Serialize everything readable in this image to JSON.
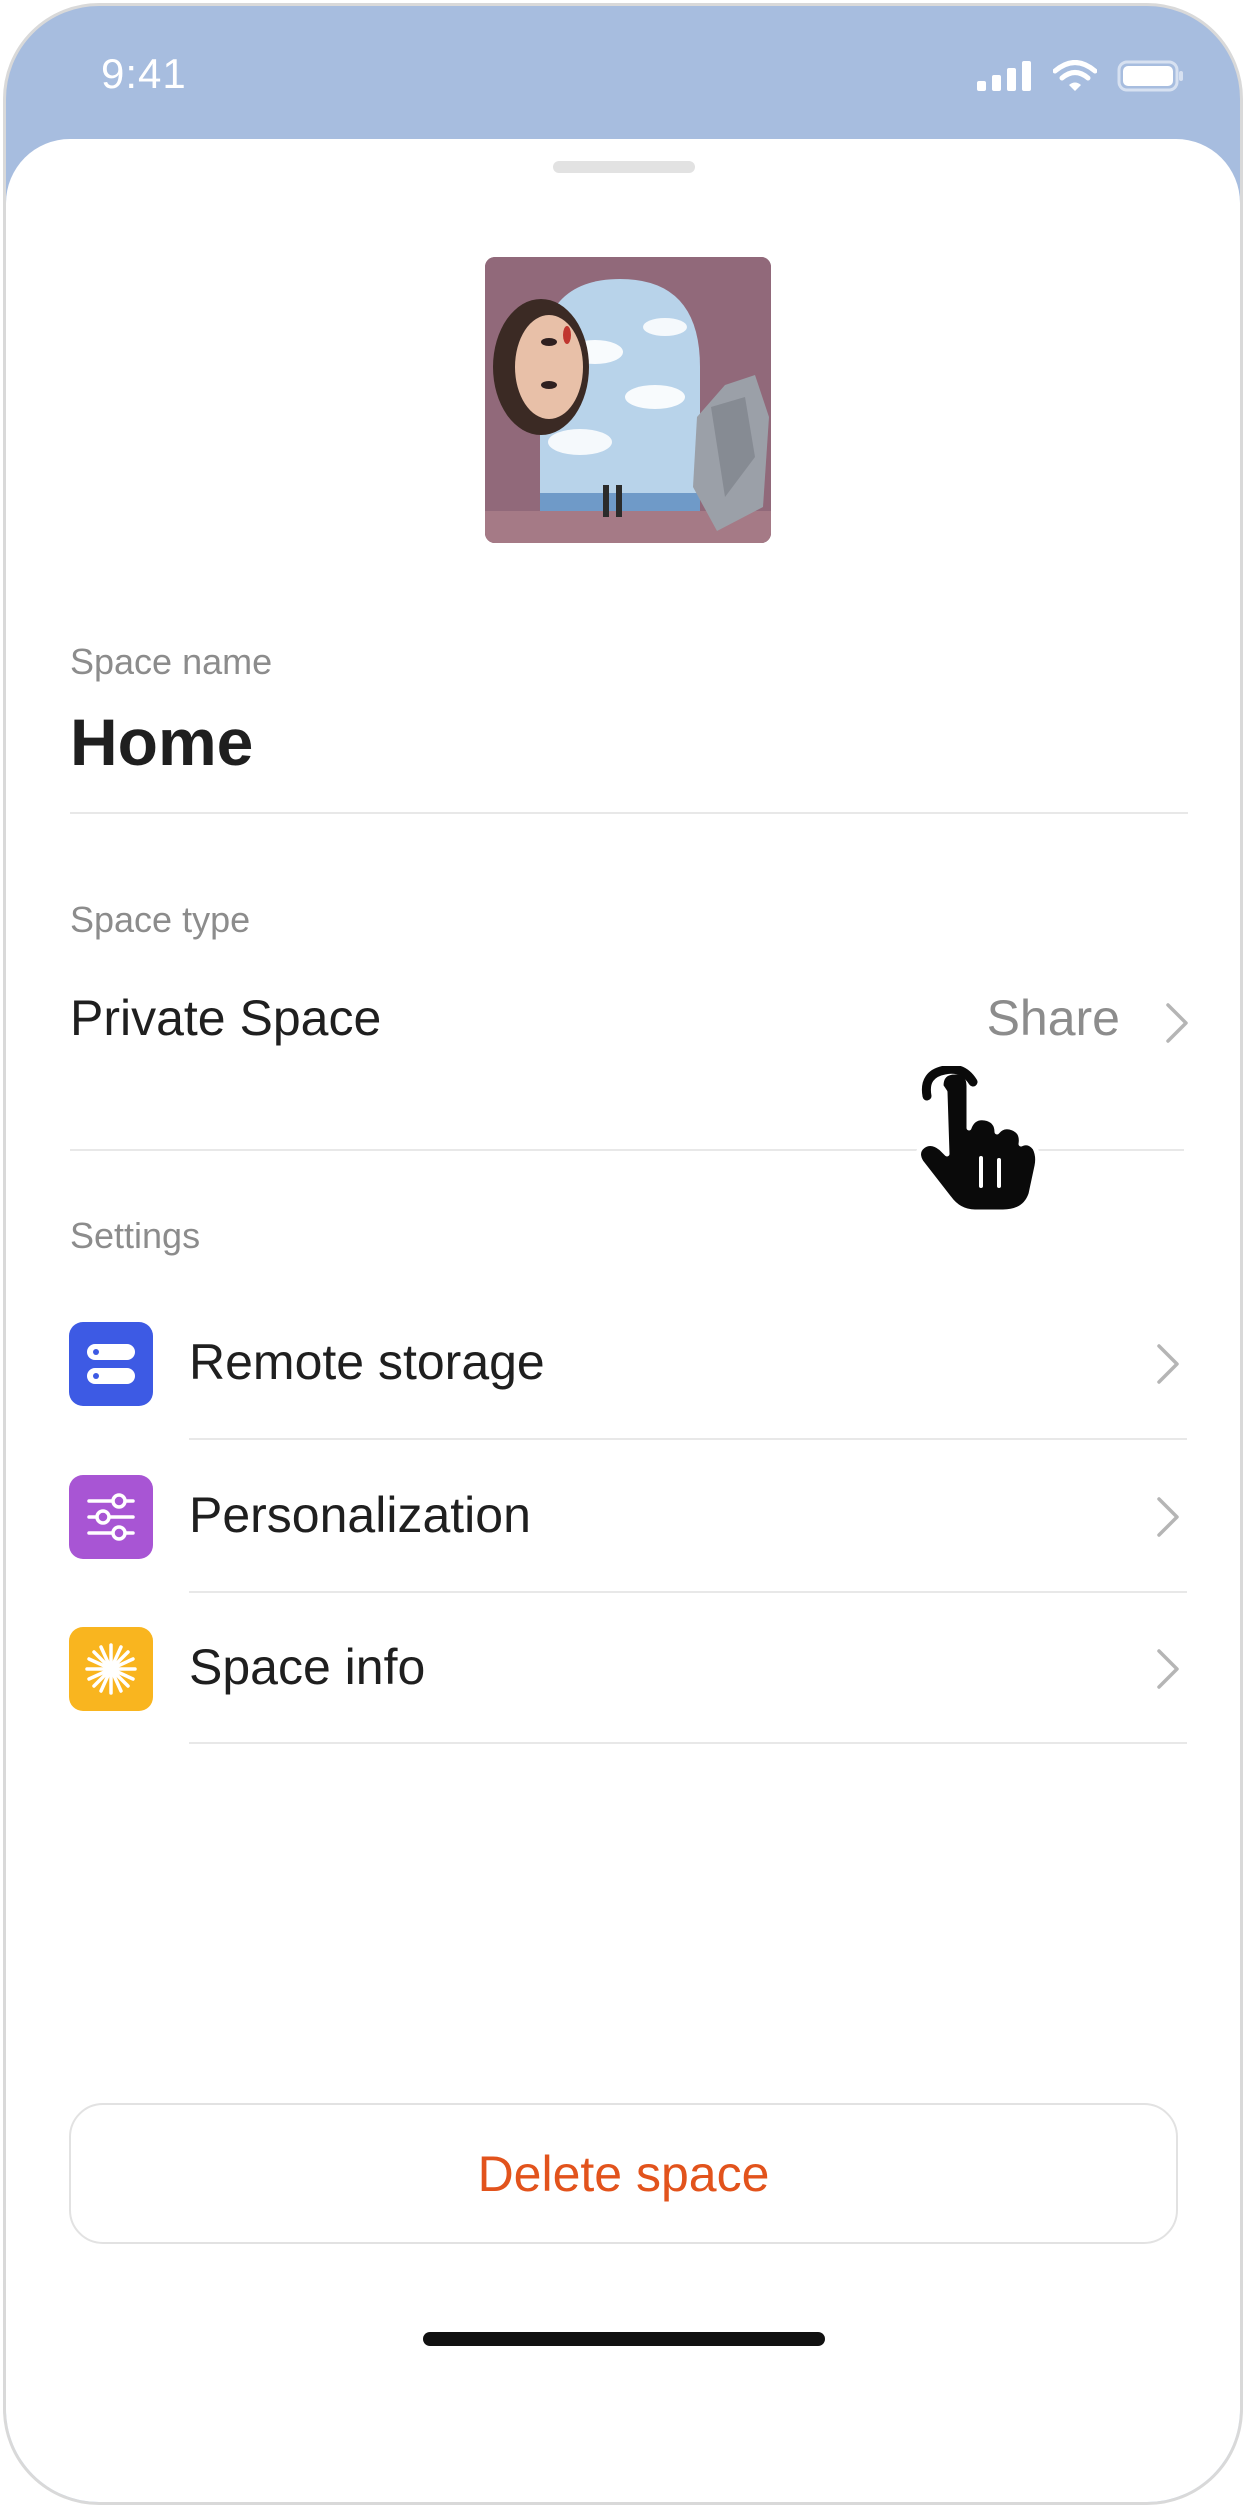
{
  "status_bar": {
    "time": "9:41",
    "icons": [
      "signal-icon",
      "wifi-icon",
      "battery-icon"
    ]
  },
  "space": {
    "name_label": "Space name",
    "name": "Home",
    "type_label": "Space type",
    "type": "Private Space",
    "share_label": "Share"
  },
  "settings": {
    "label": "Settings",
    "items": [
      {
        "label": "Remote storage",
        "icon": "storage-icon",
        "color": "#3d5ae4"
      },
      {
        "label": "Personalization",
        "icon": "sliders-icon",
        "color": "#a855d4"
      },
      {
        "label": "Space info",
        "icon": "sparkle-icon",
        "color": "#f9b51f"
      }
    ]
  },
  "delete_button": {
    "label": "Delete space",
    "color": "#e2531c"
  },
  "colors": {
    "status_bar_bg": "#a7bddf",
    "text_primary": "#1f1f1f",
    "text_secondary": "#8c8c8c"
  }
}
